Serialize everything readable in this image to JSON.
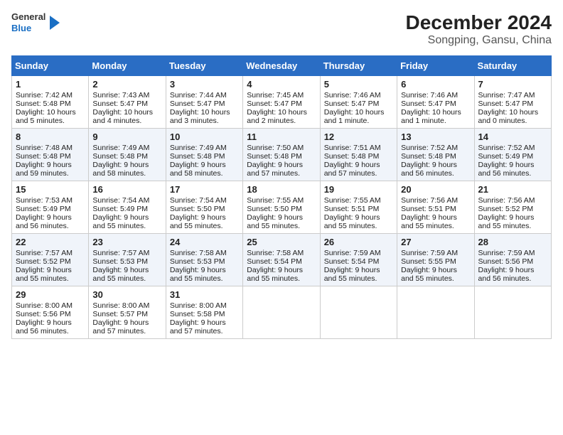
{
  "header": {
    "logo": {
      "line1": "General",
      "line2": "Blue"
    },
    "title": "December 2024",
    "subtitle": "Songping, Gansu, China"
  },
  "days_of_week": [
    "Sunday",
    "Monday",
    "Tuesday",
    "Wednesday",
    "Thursday",
    "Friday",
    "Saturday"
  ],
  "weeks": [
    [
      {
        "day": 1,
        "sunrise": "7:42 AM",
        "sunset": "5:48 PM",
        "daylight": "10 hours and 5 minutes."
      },
      {
        "day": 2,
        "sunrise": "7:43 AM",
        "sunset": "5:47 PM",
        "daylight": "10 hours and 4 minutes."
      },
      {
        "day": 3,
        "sunrise": "7:44 AM",
        "sunset": "5:47 PM",
        "daylight": "10 hours and 3 minutes."
      },
      {
        "day": 4,
        "sunrise": "7:45 AM",
        "sunset": "5:47 PM",
        "daylight": "10 hours and 2 minutes."
      },
      {
        "day": 5,
        "sunrise": "7:46 AM",
        "sunset": "5:47 PM",
        "daylight": "10 hours and 1 minute."
      },
      {
        "day": 6,
        "sunrise": "7:46 AM",
        "sunset": "5:47 PM",
        "daylight": "10 hours and 1 minute."
      },
      {
        "day": 7,
        "sunrise": "7:47 AM",
        "sunset": "5:47 PM",
        "daylight": "10 hours and 0 minutes."
      }
    ],
    [
      {
        "day": 8,
        "sunrise": "7:48 AM",
        "sunset": "5:48 PM",
        "daylight": "9 hours and 59 minutes."
      },
      {
        "day": 9,
        "sunrise": "7:49 AM",
        "sunset": "5:48 PM",
        "daylight": "9 hours and 58 minutes."
      },
      {
        "day": 10,
        "sunrise": "7:49 AM",
        "sunset": "5:48 PM",
        "daylight": "9 hours and 58 minutes."
      },
      {
        "day": 11,
        "sunrise": "7:50 AM",
        "sunset": "5:48 PM",
        "daylight": "9 hours and 57 minutes."
      },
      {
        "day": 12,
        "sunrise": "7:51 AM",
        "sunset": "5:48 PM",
        "daylight": "9 hours and 57 minutes."
      },
      {
        "day": 13,
        "sunrise": "7:52 AM",
        "sunset": "5:48 PM",
        "daylight": "9 hours and 56 minutes."
      },
      {
        "day": 14,
        "sunrise": "7:52 AM",
        "sunset": "5:49 PM",
        "daylight": "9 hours and 56 minutes."
      }
    ],
    [
      {
        "day": 15,
        "sunrise": "7:53 AM",
        "sunset": "5:49 PM",
        "daylight": "9 hours and 56 minutes."
      },
      {
        "day": 16,
        "sunrise": "7:54 AM",
        "sunset": "5:49 PM",
        "daylight": "9 hours and 55 minutes."
      },
      {
        "day": 17,
        "sunrise": "7:54 AM",
        "sunset": "5:50 PM",
        "daylight": "9 hours and 55 minutes."
      },
      {
        "day": 18,
        "sunrise": "7:55 AM",
        "sunset": "5:50 PM",
        "daylight": "9 hours and 55 minutes."
      },
      {
        "day": 19,
        "sunrise": "7:55 AM",
        "sunset": "5:51 PM",
        "daylight": "9 hours and 55 minutes."
      },
      {
        "day": 20,
        "sunrise": "7:56 AM",
        "sunset": "5:51 PM",
        "daylight": "9 hours and 55 minutes."
      },
      {
        "day": 21,
        "sunrise": "7:56 AM",
        "sunset": "5:52 PM",
        "daylight": "9 hours and 55 minutes."
      }
    ],
    [
      {
        "day": 22,
        "sunrise": "7:57 AM",
        "sunset": "5:52 PM",
        "daylight": "9 hours and 55 minutes."
      },
      {
        "day": 23,
        "sunrise": "7:57 AM",
        "sunset": "5:53 PM",
        "daylight": "9 hours and 55 minutes."
      },
      {
        "day": 24,
        "sunrise": "7:58 AM",
        "sunset": "5:53 PM",
        "daylight": "9 hours and 55 minutes."
      },
      {
        "day": 25,
        "sunrise": "7:58 AM",
        "sunset": "5:54 PM",
        "daylight": "9 hours and 55 minutes."
      },
      {
        "day": 26,
        "sunrise": "7:59 AM",
        "sunset": "5:54 PM",
        "daylight": "9 hours and 55 minutes."
      },
      {
        "day": 27,
        "sunrise": "7:59 AM",
        "sunset": "5:55 PM",
        "daylight": "9 hours and 55 minutes."
      },
      {
        "day": 28,
        "sunrise": "7:59 AM",
        "sunset": "5:56 PM",
        "daylight": "9 hours and 56 minutes."
      }
    ],
    [
      {
        "day": 29,
        "sunrise": "8:00 AM",
        "sunset": "5:56 PM",
        "daylight": "9 hours and 56 minutes."
      },
      {
        "day": 30,
        "sunrise": "8:00 AM",
        "sunset": "5:57 PM",
        "daylight": "9 hours and 57 minutes."
      },
      {
        "day": 31,
        "sunrise": "8:00 AM",
        "sunset": "5:58 PM",
        "daylight": "9 hours and 57 minutes."
      },
      null,
      null,
      null,
      null
    ]
  ]
}
